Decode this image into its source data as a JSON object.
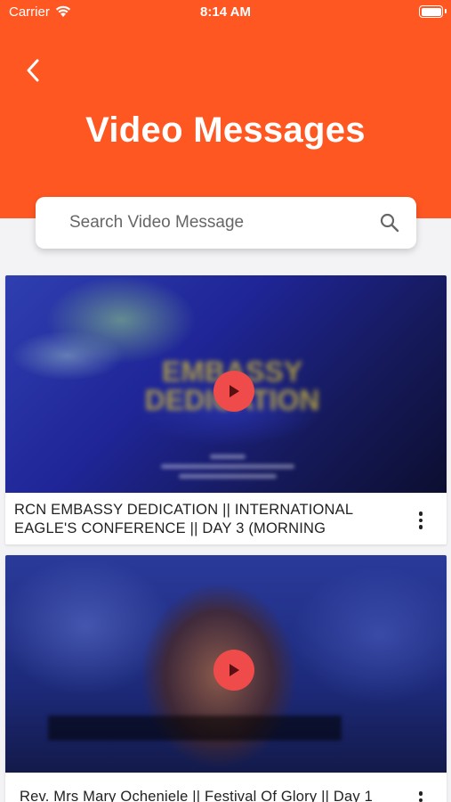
{
  "status_bar": {
    "carrier": "Carrier",
    "time": "8:14 AM"
  },
  "header": {
    "title": "Video Messages",
    "background_color": "#ff5722"
  },
  "search": {
    "placeholder": "Search Video Message",
    "value": ""
  },
  "videos": [
    {
      "title": "RCN EMBASSY DEDICATION || INTERNATIONAL EAGLE'S CONFERENCE || DAY 3 (MORNING",
      "thumbnail_text": "EMBASSY DEDICATION"
    },
    {
      "title": "Rev. Mrs Mary Ocheniele || Festival Of Glory || Day 1"
    }
  ],
  "colors": {
    "accent": "#ff5722",
    "play_button": "#f04b4b"
  },
  "icons": [
    "wifi-icon",
    "battery-icon",
    "back-arrow-icon",
    "search-icon",
    "play-icon",
    "more-vert-icon"
  ]
}
